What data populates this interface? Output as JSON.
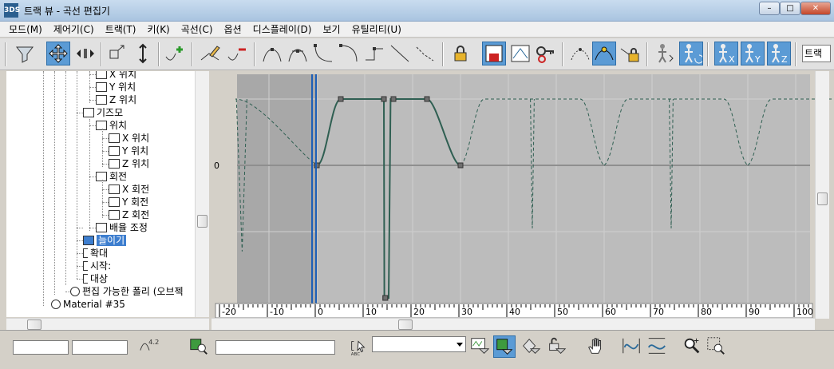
{
  "window": {
    "app_icon_text": "3DS",
    "title": "트랙 뷰 - 곡선 편집기",
    "minimize_label": "–",
    "maximize_label": "□",
    "close_label": "✕"
  },
  "menu": {
    "items": [
      "모드(M)",
      "제어기(C)",
      "트랙(T)",
      "키(K)",
      "곡선(C)",
      "옵션",
      "디스플레이(D)",
      "보기",
      "유틸리티(U)"
    ]
  },
  "toolbar": {
    "field_text": "트랙",
    "icons": [
      "filter-icon",
      "move-keys-icon",
      "slide-keys-icon",
      "scale-keys-icon",
      "scale-values-icon",
      "add-keys-icon",
      "draw-curves-icon",
      "reduce-keys-icon",
      "tangent-auto-icon",
      "tangent-custom-icon",
      "tangent-fast-icon",
      "tangent-slow-icon",
      "tangent-step-icon",
      "tangent-linear-icon",
      "tangent-smooth-icon",
      "lock-selection-icon",
      "snap-frames-icon",
      "parameter-curve-out-of-range-icon",
      "show-keyable-icon",
      "show-all-tangents-icon",
      "show-tangents-icon",
      "lock-tangents-icon",
      "show-biped-position-icon",
      "show-biped-rotation-icon",
      "biped-x-icon",
      "biped-y-icon",
      "biped-z-icon"
    ]
  },
  "tree": {
    "items": [
      {
        "label": "X 위치",
        "icon": "curve-track-icon"
      },
      {
        "label": "Y 위치",
        "icon": "curve-track-icon"
      },
      {
        "label": "Z 위치",
        "icon": "curve-track-icon"
      },
      {
        "label": "기즈모",
        "icon": "controller-icon"
      },
      {
        "label": "위치",
        "icon": "position-icon"
      },
      {
        "label": "X 위치",
        "icon": "curve-track-icon"
      },
      {
        "label": "Y 위치",
        "icon": "curve-track-icon"
      },
      {
        "label": "Z 위치",
        "icon": "curve-track-icon"
      },
      {
        "label": "회전",
        "icon": "rotation-icon"
      },
      {
        "label": "X 회전",
        "icon": "curve-track-icon"
      },
      {
        "label": "Y 회전",
        "icon": "curve-track-icon"
      },
      {
        "label": "Z 회전",
        "icon": "curve-track-icon"
      },
      {
        "label": "배율 조정",
        "icon": "scale-icon"
      },
      {
        "label": "늘이기",
        "icon": "curve-track-icon",
        "selected": true
      },
      {
        "label": "확대",
        "icon": "bracket-icon"
      },
      {
        "label": "시작:",
        "icon": "bracket-icon"
      },
      {
        "label": "대상",
        "icon": "bracket-icon"
      },
      {
        "label": "편집 가능한 폴리 (오브젝",
        "icon": "editable-poly-icon"
      },
      {
        "label": "Material #35",
        "icon": "material-icon"
      }
    ]
  },
  "graph": {
    "zero_label": "0",
    "ruler_ticks": [
      "-20",
      "-10",
      "0",
      "10",
      "20",
      "30",
      "40",
      "50",
      "60",
      "70",
      "80",
      "90",
      "100"
    ],
    "current_frame": -0.5,
    "active_range": [
      0,
      30
    ],
    "curve_color": "#2f5f52",
    "key_color": "#6f6f6f"
  },
  "chart_data": {
    "type": "line",
    "title": "",
    "xlabel": "",
    "ylabel": "",
    "xlim": [
      -22,
      102
    ],
    "grid": true,
    "series": [
      {
        "name": "",
        "style": "solid",
        "x": [
          0,
          5,
          14,
          14.3,
          15,
          15.5,
          16,
          23,
          30
        ],
        "y": [
          0,
          1,
          1,
          -2,
          -2,
          1,
          1,
          1,
          0
        ]
      }
    ],
    "out_of_range_pattern": "ping-pong repeat (dashed)",
    "keys": [
      {
        "x": 0,
        "y": 0
      },
      {
        "x": 5,
        "y": 1
      },
      {
        "x": 14,
        "y": 1
      },
      {
        "x": 14.3,
        "y": -2
      },
      {
        "x": 16,
        "y": 1
      },
      {
        "x": 23,
        "y": 1
      },
      {
        "x": 30,
        "y": 0
      }
    ]
  },
  "status": {
    "field1": "",
    "field2": "",
    "value_badge": "4.2",
    "name_field": "",
    "combo_value": "",
    "icons": [
      "curve-value-icon",
      "zoom-selected-object-icon",
      "name-text-icon",
      "abc-icon",
      "filter-selected-tracks-icon",
      "filter-selected-objects-icon",
      "filter-animated-tracks-icon",
      "filter-unlocked-attributes-icon",
      "pan-icon",
      "zoom-horizontal-extents-icon",
      "zoom-value-extents-icon",
      "zoom-icon",
      "zoom-region-icon"
    ]
  }
}
